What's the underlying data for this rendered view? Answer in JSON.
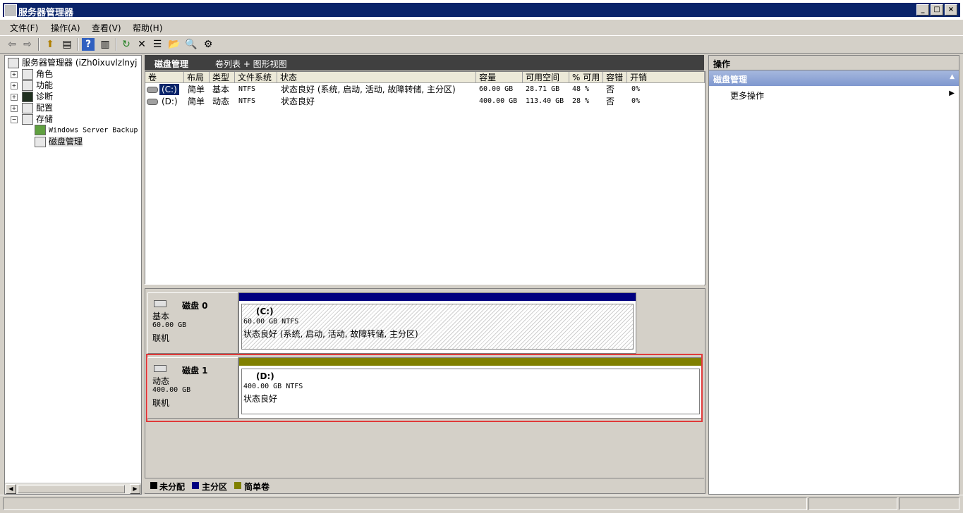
{
  "window": {
    "title": "服务器管理器",
    "min": "_",
    "max": "□",
    "close": "×"
  },
  "menu": [
    "文件(F)",
    "操作(A)",
    "查看(V)",
    "帮助(H)"
  ],
  "tree": {
    "root": "服务器管理器 (iZh0ixuvlzlnyj",
    "items": [
      {
        "label": "角色",
        "expander": "+"
      },
      {
        "label": "功能",
        "expander": "+"
      },
      {
        "label": "诊断",
        "expander": "+"
      },
      {
        "label": "配置",
        "expander": "+"
      },
      {
        "label": "存储",
        "expander": "−"
      }
    ],
    "children": [
      "Windows Server Backup",
      "磁盘管理"
    ],
    "scroll_left": "◀",
    "scroll_right": "▶"
  },
  "center": {
    "title": "磁盘管理",
    "view": "卷列表 + 图形视图",
    "columns": [
      "卷",
      "布局",
      "类型",
      "文件系统",
      "状态",
      "容量",
      "可用空间",
      "% 可用",
      "容错",
      "开销"
    ],
    "rows": [
      [
        "(C:)",
        "简单",
        "基本",
        "NTFS",
        "状态良好 (系统, 启动, 活动, 故障转储, 主分区)",
        "60.00 GB",
        "28.71 GB",
        "48 %",
        "否",
        "0%"
      ],
      [
        "(D:)",
        "简单",
        "动态",
        "NTFS",
        "状态良好",
        "400.00 GB",
        "113.40 GB",
        "28 %",
        "否",
        "0%"
      ]
    ]
  },
  "disks": [
    {
      "name": "磁盘 0",
      "type": "基本",
      "size": "60.00 GB",
      "status": "联机",
      "part_name": "(C:)",
      "part_size": "60.00 GB NTFS",
      "part_status": "状态良好 (系统, 启动, 活动, 故障转储, 主分区)",
      "bar_color": "#000080"
    },
    {
      "name": "磁盘 1",
      "type": "动态",
      "size": "400.00 GB",
      "status": "联机",
      "part_name": "(D:)",
      "part_size": "400.00 GB NTFS",
      "part_status": "状态良好",
      "bar_color": "#808000"
    }
  ],
  "legend": [
    {
      "label": "未分配",
      "color": "#000000"
    },
    {
      "label": "主分区",
      "color": "#000080"
    },
    {
      "label": "简单卷",
      "color": "#808000"
    }
  ],
  "actions": {
    "header": "操作",
    "section": "磁盘管理",
    "section_arrow": "▲",
    "more": "更多操作",
    "more_arrow": "▶"
  }
}
